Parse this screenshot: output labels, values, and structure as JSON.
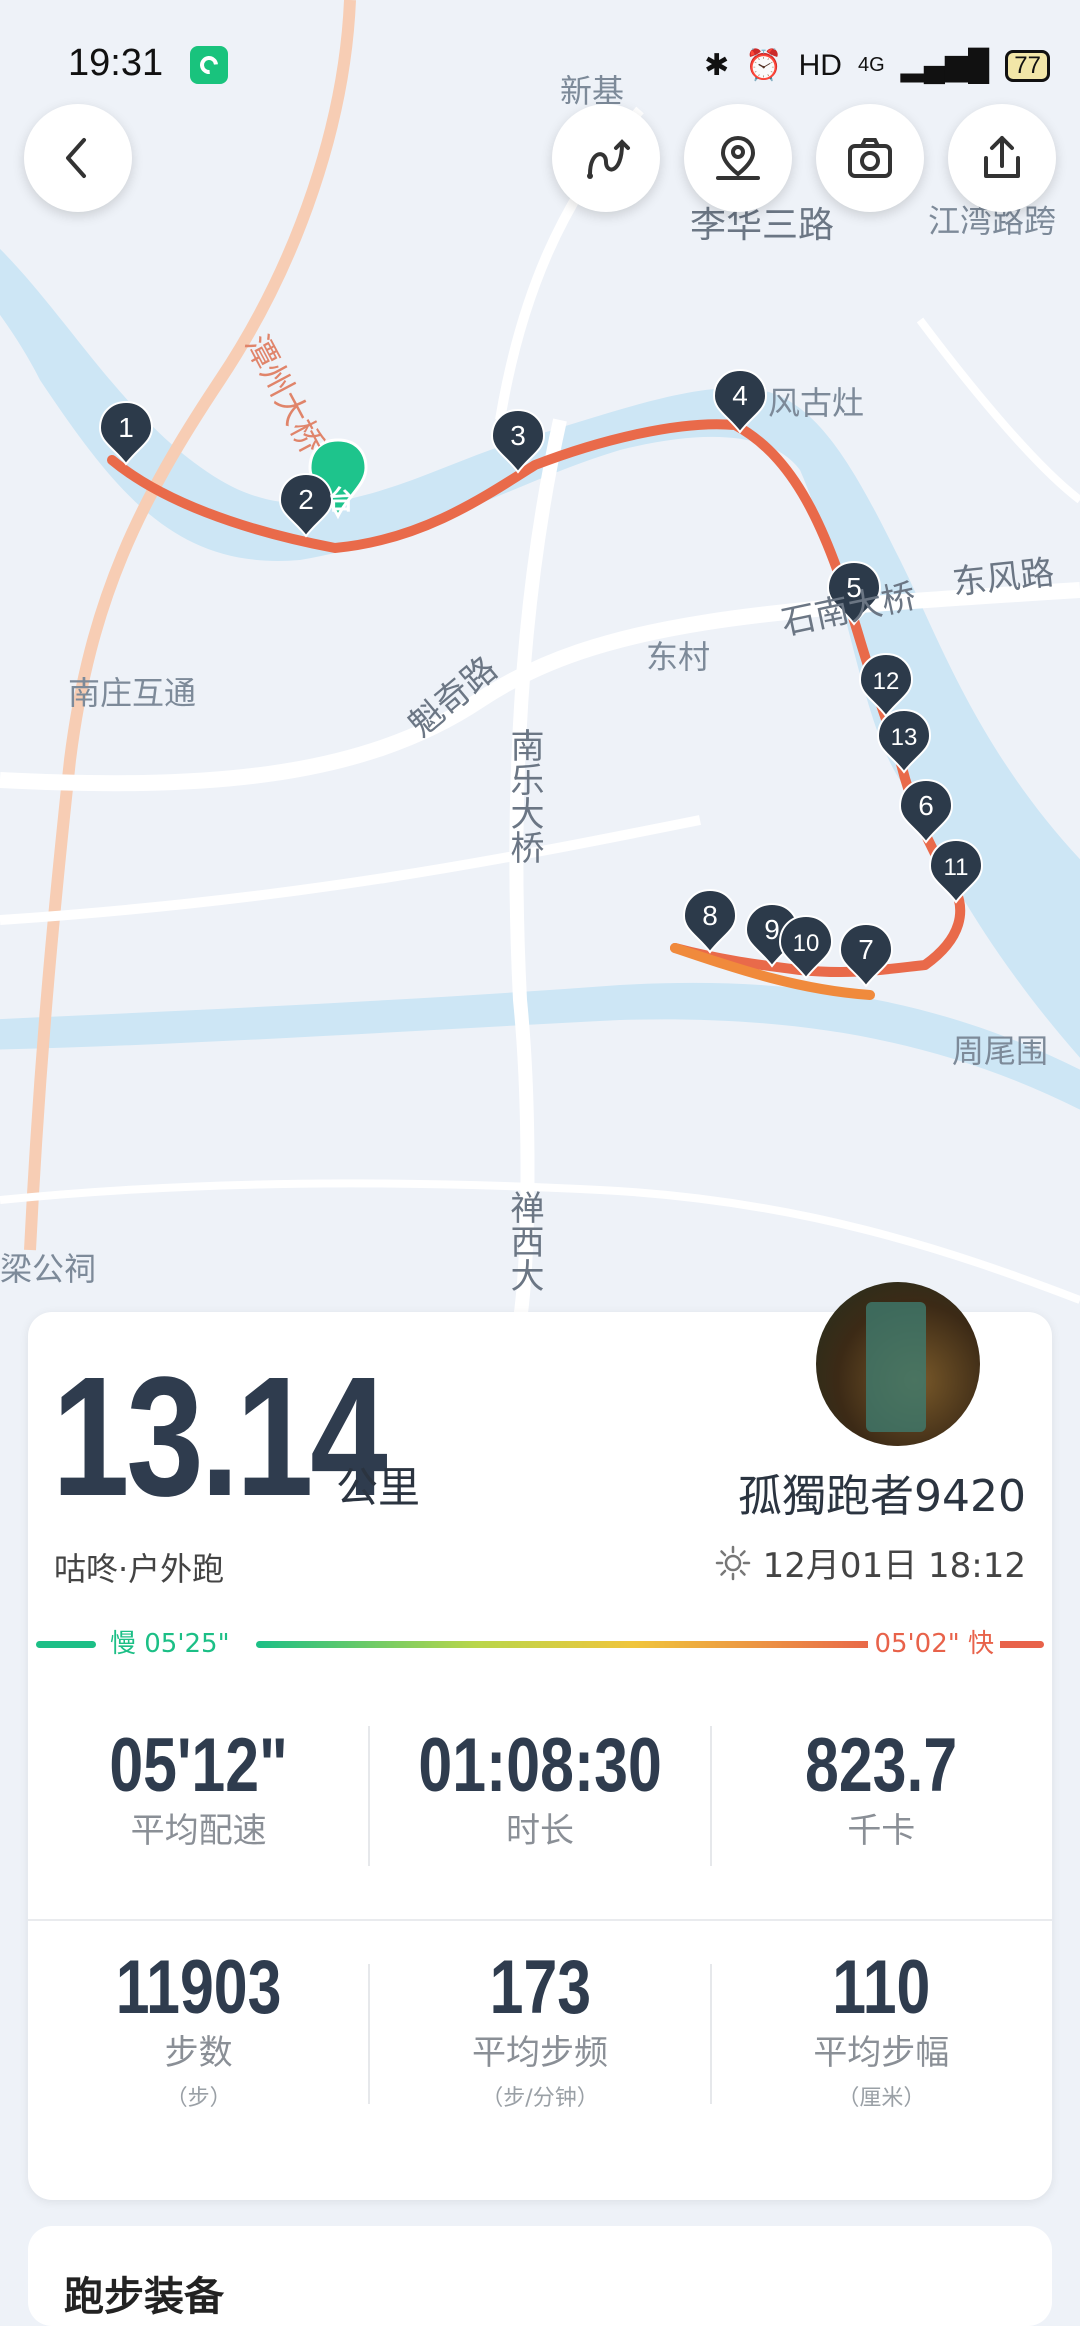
{
  "status_bar": {
    "time": "19:31",
    "network": "HD",
    "signal": "4G",
    "battery": "77"
  },
  "toolbar": {
    "back": "back-icon",
    "route_replay": "route-replay-icon",
    "location": "location-icon",
    "camera": "camera-icon",
    "share": "share-icon"
  },
  "map": {
    "labels": [
      "新基",
      "李华三路",
      "江湾路跨",
      "风古灶",
      "石南大桥",
      "东风路",
      "东村",
      "魁奇路",
      "南庄互通",
      "南乐大桥",
      "周尾围",
      "禅西大",
      "梁公祠",
      "潭州大桥"
    ],
    "start_label": "台",
    "markers": [
      "1",
      "2",
      "3",
      "4",
      "5",
      "12",
      "13",
      "6",
      "11",
      "8",
      "9",
      "10",
      "7"
    ],
    "route_color": "#e96a4a",
    "water_color": "#cde6f5"
  },
  "summary": {
    "distance": "13.14",
    "distance_unit": "公里",
    "username": "孤獨跑者9420",
    "activity": "咕咚·户外跑",
    "datetime": "12月01日 18:12",
    "pace_slow": "慢 05'25\"",
    "pace_fast": "05'02\" 快",
    "colors": {
      "slow": "#1cbf86",
      "fast": "#e8624a"
    }
  },
  "stats_row1": [
    {
      "value": "05'12\"",
      "label": "平均配速"
    },
    {
      "value": "01:08:30",
      "label": "时长"
    },
    {
      "value": "823.7",
      "label": "千卡"
    }
  ],
  "stats_row2": [
    {
      "value": "11903",
      "label": "步数",
      "sub": "（步）"
    },
    {
      "value": "173",
      "label": "平均步频",
      "sub": "（步/分钟）"
    },
    {
      "value": "110",
      "label": "平均步幅",
      "sub": "（厘米）"
    }
  ],
  "next_card": {
    "title": "跑步装备"
  }
}
